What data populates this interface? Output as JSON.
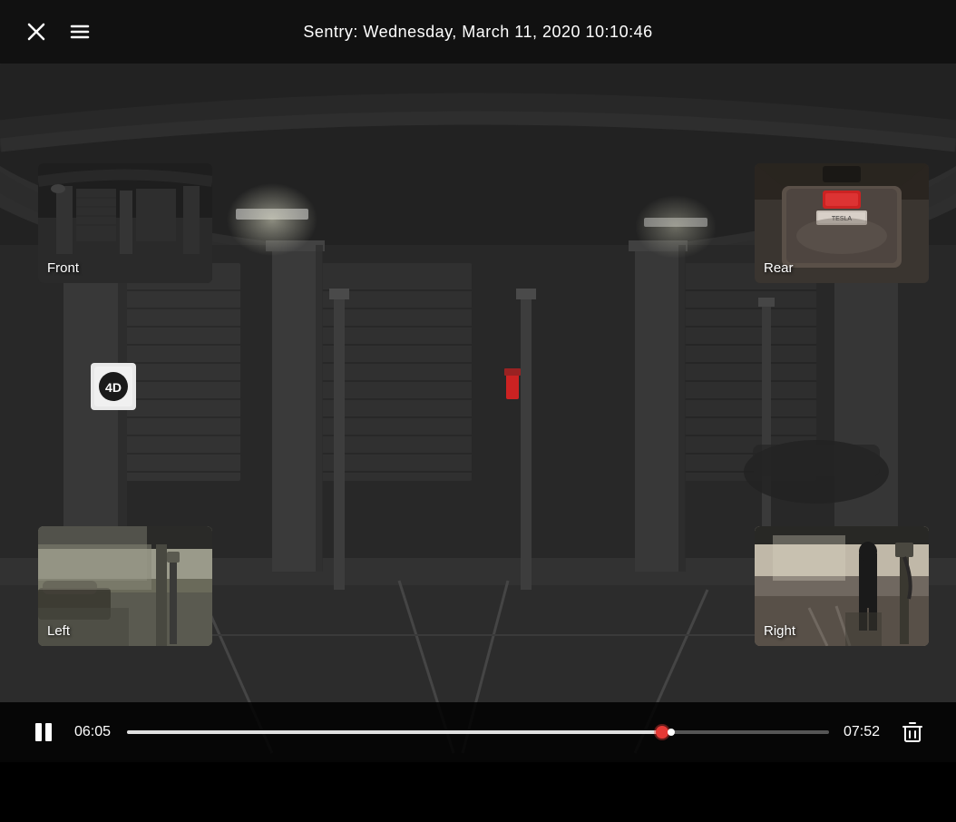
{
  "header": {
    "title": "Sentry: Wednesday, March 11, 2020 10:10:46"
  },
  "cameras": {
    "front": {
      "label": "Front"
    },
    "rear": {
      "label": "Rear"
    },
    "left": {
      "label": "Left"
    },
    "right": {
      "label": "Right"
    }
  },
  "controls": {
    "current_time": "06:05",
    "total_time": "07:52",
    "progress_percent": 77
  },
  "icons": {
    "close": "close-icon",
    "menu": "menu-icon",
    "pause": "pause-icon",
    "delete": "trash-icon"
  },
  "colors": {
    "background": "#111111",
    "progress_fill": "#e0e0e0",
    "progress_handle": "#e53935",
    "text": "#ffffff"
  }
}
